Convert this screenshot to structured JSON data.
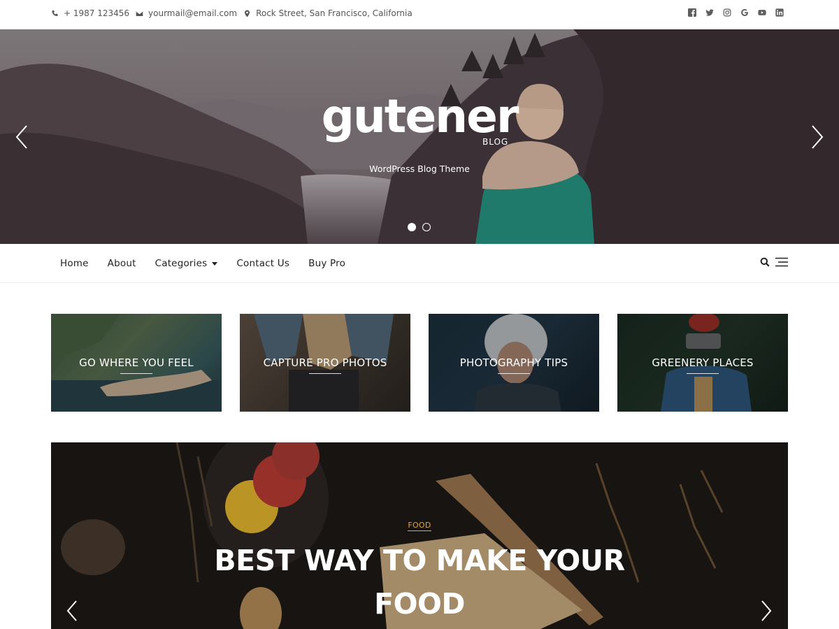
{
  "topbar": {
    "phone": "+ 1987 123456",
    "email": "yourmail@email.com",
    "address": "Rock Street, San Francisco, California",
    "socials": [
      "facebook-icon",
      "twitter-icon",
      "instagram-icon",
      "google-icon",
      "youtube-icon",
      "linkedin-icon"
    ]
  },
  "hero": {
    "logo": "gutener",
    "logo_sub": "BLOG",
    "tagline": "WordPress Blog Theme",
    "slides_total": 2,
    "active_slide": 1
  },
  "nav": {
    "items": [
      {
        "label": "Home"
      },
      {
        "label": "About"
      },
      {
        "label": "Categories",
        "dropdown": true
      },
      {
        "label": "Contact Us"
      },
      {
        "label": "Buy Pro"
      }
    ]
  },
  "tiles": [
    {
      "label": "GO WHERE YOU FEEL"
    },
    {
      "label": "CAPTURE PRO PHOTOS"
    },
    {
      "label": "PHOTOGRAPHY TIPS"
    },
    {
      "label": "GREENERY PLACES"
    }
  ],
  "featured": {
    "category": "FOOD",
    "title": "BEST WAY TO MAKE YOUR FOOD"
  },
  "colors": {
    "accent": "#e8a23b",
    "text": "#222222",
    "muted": "#555555"
  }
}
